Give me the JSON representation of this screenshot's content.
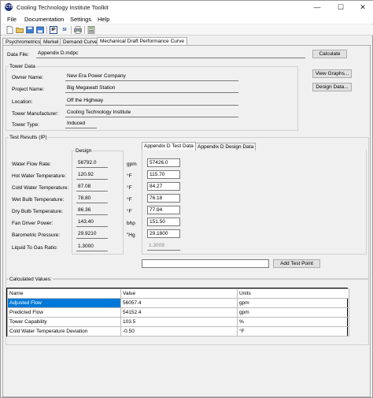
{
  "window": {
    "title": "Cooling Technology Institute Toolkit",
    "icon_text": "CTI",
    "minimize": "—",
    "maximize": "☐",
    "close": "✕"
  },
  "menu": [
    "File",
    "Documentation",
    "Settings",
    "Help"
  ],
  "toolbar": {
    "icons": [
      "new-file-icon",
      "open-folder-icon",
      "save-icon",
      "save-all-icon",
      "ip-units-icon",
      "si-units-icon",
      "print-icon",
      "calculator-icon"
    ],
    "ip_label": "IP",
    "si_label": "SI"
  },
  "tabs": [
    "Psychrometrics",
    "Merkel",
    "Demand Curve",
    "Mechanical Draft Performance Curve"
  ],
  "data_file": {
    "label": "Data File:",
    "value": "Appendix D.mdpc",
    "calculate": "Calculate"
  },
  "tower_data": {
    "title": "Tower Data",
    "rows": [
      {
        "label": "Owner Name:",
        "value": "New Era Power Company"
      },
      {
        "label": "Project Name:",
        "value": "Big Megawatt Station"
      },
      {
        "label": "Location:",
        "value": "Off the Highway"
      },
      {
        "label": "Tower Manufacturer:",
        "value": "Cooling Technology Institute"
      },
      {
        "label": "Tower Type:",
        "value": "Induced"
      }
    ],
    "view_graphs": "View Graphs...",
    "design_data": "Design Data..."
  },
  "test_results": {
    "title": "Test Results (IP)",
    "design_title": "Design",
    "tab_test": "Appendix D Test Data",
    "tab_design": "Appendix D Design Data",
    "rows": [
      {
        "label": "Water Flow Rate:",
        "design": "56792.0",
        "unit": "gpm",
        "test": "57426.0"
      },
      {
        "label": "Hot Water Temperature:",
        "design": "120.92",
        "unit": "°F",
        "test": "115.70"
      },
      {
        "label": "Cold Water Temperature:",
        "design": "87.08",
        "unit": "°F",
        "test": "84.27"
      },
      {
        "label": "Wet Bulb Temperature:",
        "design": "78.80",
        "unit": "°F",
        "test": "76.18"
      },
      {
        "label": "Dry Bulb Temperature:",
        "design": "86.36",
        "unit": "°F",
        "test": "77.94"
      },
      {
        "label": "Fan Driver Power:",
        "design": "143.40",
        "unit": "bhp",
        "test": "151.50"
      },
      {
        "label": "Barometric Pressure:",
        "design": "29.9210",
        "unit": "\"Hg",
        "test": "29.1800"
      },
      {
        "label": "Liquid To Gas Ratio:",
        "design": "1.3000",
        "unit": "",
        "test": "1.3009"
      }
    ],
    "add_test_point": "Add Test Point"
  },
  "calculated": {
    "title": "Calculated Values:",
    "headers": [
      "Name",
      "Value",
      "Units"
    ],
    "rows": [
      {
        "name": "Adjusted Flow",
        "value": "56057.4",
        "units": "gpm"
      },
      {
        "name": "Predicted Flow",
        "value": "54152.4",
        "units": "gpm"
      },
      {
        "name": "Tower Capability",
        "value": "103.5",
        "units": "%"
      },
      {
        "name": "Cold Water Temperature Deviation",
        "value": "-0.50",
        "units": "°F"
      }
    ]
  }
}
